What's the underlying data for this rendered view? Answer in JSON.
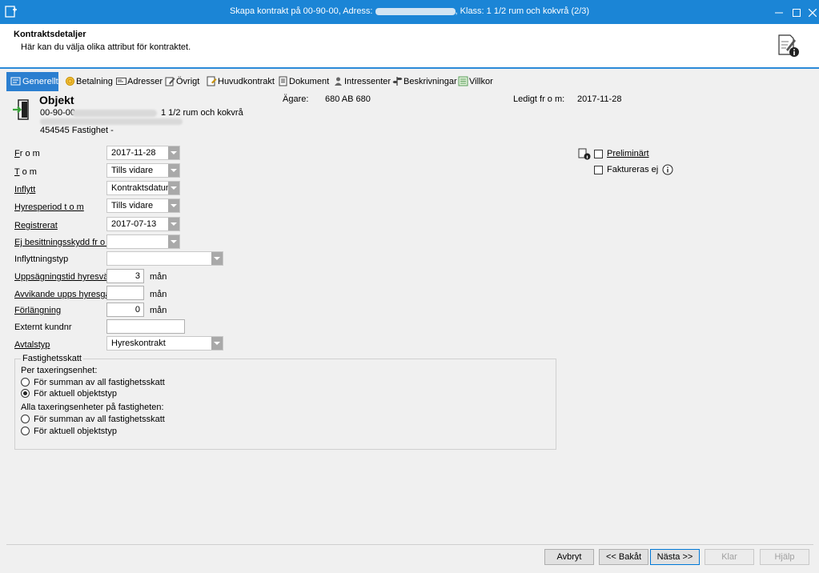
{
  "window": {
    "title_left": "Skapa kontrakt på 00-90-00, Adress: ",
    "title_right": ", Klass: 1 1/2 rum och kokvrå (2/3)"
  },
  "header": {
    "title": "Kontraktsdetaljer",
    "subtitle": "Här kan du välja olika attribut för kontraktet."
  },
  "tabs": [
    {
      "label": "Generellt",
      "icon": "general-icon"
    },
    {
      "label": "Betalning",
      "icon": "coins-icon"
    },
    {
      "label": "Adresser",
      "icon": "address-card-icon"
    },
    {
      "label": "Övrigt",
      "icon": "edit-icon"
    },
    {
      "label": "Huvudkontrakt",
      "icon": "main-contract-icon"
    },
    {
      "label": "Dokument",
      "icon": "document-icon"
    },
    {
      "label": "Intressenter",
      "icon": "people-icon"
    },
    {
      "label": "Beskrivningar",
      "icon": "signpost-icon"
    },
    {
      "label": "Villkor",
      "icon": "list-icon"
    }
  ],
  "object": {
    "heading": "Objekt",
    "line1_prefix": "00-90-00",
    "line1_suffix": "1 1/2 rum och kokvrå",
    "line3": "454545 Fastighet -",
    "owner_label": "Ägare:",
    "owner_value": "680 AB 680",
    "free_label": "Ledigt fr o m:",
    "free_value": "2017-11-28"
  },
  "form": {
    "from_label_u": "F",
    "from_label": "r o m",
    "from_value": "2017-11-28",
    "tom_label_u": "T",
    "tom_label": " o m",
    "tom_value": "Tills vidare",
    "inflytt_label": "Inflytt",
    "inflytt_value": "Kontraktsdatum",
    "hyresperiod_label": "Hyresperiod t o m",
    "hyresperiod_value": "Tills vidare",
    "registrerat_label": "Registrerat",
    "registrerat_value": "2017-07-13",
    "besittning_label": "Ej besittningsskydd fr o m",
    "besittning_value": "",
    "inflyttningstyp_label": "Inflyttningstyp",
    "inflyttningstyp_value": "",
    "uppsagning_label": "Uppsägningstid hyresvärd",
    "uppsagning_value": "3",
    "uppsagning_unit": "mån",
    "avvikande_label": "Avvikande upps hyresgäst",
    "avvikande_value": "",
    "avvikande_unit": "mån",
    "forlangning_label": "Förlängning",
    "forlangning_value": "0",
    "forlangning_unit": "mån",
    "externt_label": "Externt kundnr",
    "externt_value": "",
    "avtalstyp_label": "Avtalstyp",
    "avtalstyp_value": "Hyreskontrakt"
  },
  "right": {
    "preliminart_label": "Preliminärt",
    "faktureras_label": "Faktureras ej"
  },
  "fastighetsskatt": {
    "title": "Fastighetsskatt",
    "per_label": "Per taxeringsenhet:",
    "per_opt1": "För summan av all fastighetsskatt",
    "per_opt2": "För aktuell objektstyp",
    "alla_label": "Alla taxeringsenheter på fastigheten:",
    "alla_opt1": "För summan av all fastighetsskatt",
    "alla_opt2": "För aktuell objektstyp"
  },
  "buttons": {
    "avbryt": "Avbryt",
    "bakat": "<< Bakåt",
    "nasta": "Nästa >>",
    "klar": "Klar",
    "hjalp": "Hjälp"
  },
  "colors": {
    "titlebar": "#1b85d6",
    "tab_active": "#2b7fd0"
  }
}
